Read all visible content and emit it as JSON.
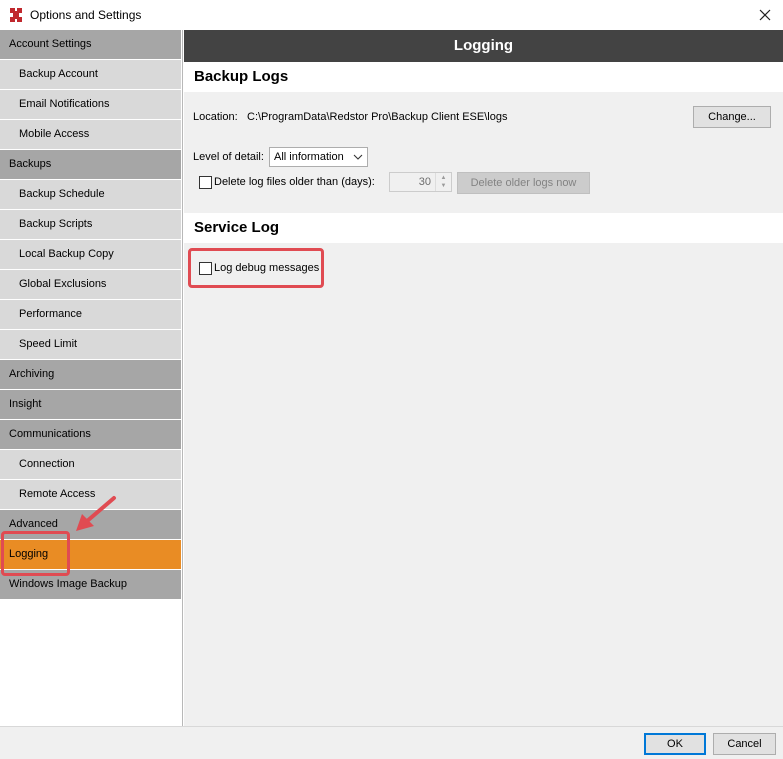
{
  "window": {
    "title": "Options and Settings",
    "close_icon": "close-icon",
    "app_icon": "redstor-logo-icon",
    "accent": "#e98c24"
  },
  "sidebar": {
    "items": [
      {
        "label": "Account Settings",
        "kind": "category"
      },
      {
        "label": "Backup Account",
        "kind": "sub"
      },
      {
        "label": "Email Notifications",
        "kind": "sub"
      },
      {
        "label": "Mobile Access",
        "kind": "sub"
      },
      {
        "label": "Backups",
        "kind": "category"
      },
      {
        "label": "Backup Schedule",
        "kind": "sub"
      },
      {
        "label": "Backup Scripts",
        "kind": "sub"
      },
      {
        "label": "Local Backup Copy",
        "kind": "sub"
      },
      {
        "label": "Global Exclusions",
        "kind": "sub"
      },
      {
        "label": "Performance",
        "kind": "sub"
      },
      {
        "label": "Speed Limit",
        "kind": "sub"
      },
      {
        "label": "Archiving",
        "kind": "category"
      },
      {
        "label": "Insight",
        "kind": "category"
      },
      {
        "label": "Communications",
        "kind": "category"
      },
      {
        "label": "Connection",
        "kind": "sub"
      },
      {
        "label": "Remote Access",
        "kind": "sub"
      },
      {
        "label": "Advanced",
        "kind": "category"
      },
      {
        "label": "Logging",
        "kind": "category",
        "selected": true
      },
      {
        "label": "Windows Image Backup",
        "kind": "category"
      }
    ]
  },
  "content": {
    "header": "Logging",
    "backup_logs": {
      "title": "Backup Logs",
      "location_label": "Location:",
      "location_value": "C:\\ProgramData\\Redstor Pro\\Backup Client ESE\\logs",
      "change_button": "Change...",
      "level_label": "Level of detail:",
      "level_value": "All information",
      "delete_label": "Delete log files older than (days):",
      "delete_checked": false,
      "days_value": "30",
      "delete_button": "Delete older logs now"
    },
    "service_log": {
      "title": "Service Log",
      "debug_label": "Log debug messages",
      "debug_checked": false
    }
  },
  "footer": {
    "ok": "OK",
    "cancel": "Cancel"
  },
  "annotations": {
    "highlight_color": "#e04b52"
  }
}
